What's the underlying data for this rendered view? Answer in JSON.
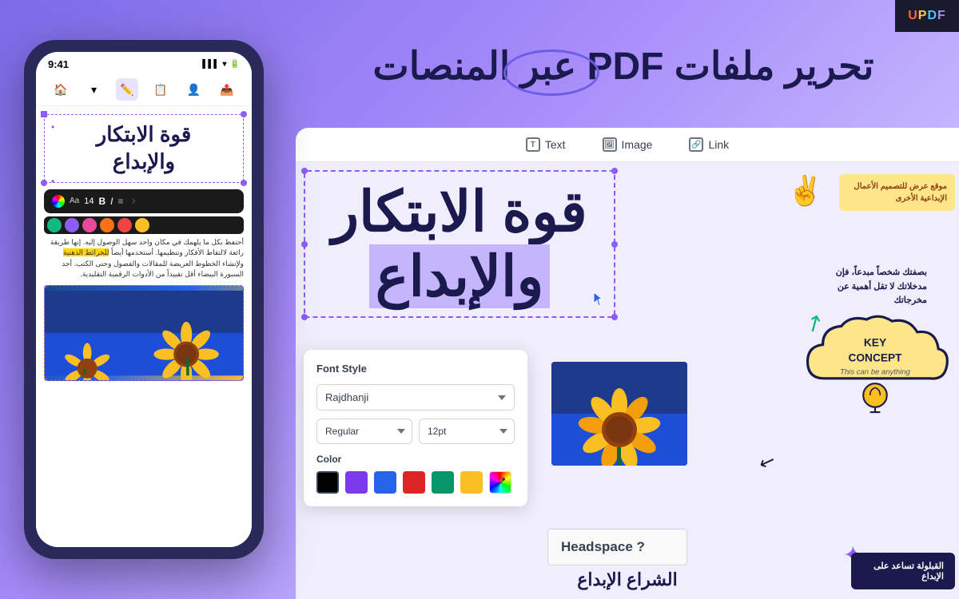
{
  "app": {
    "name": "UPDF",
    "logo_letters": {
      "u": "U",
      "p": "P",
      "d": "D",
      "f": "F"
    }
  },
  "main_title": "تحرير ملفات PDF عبر المنصات",
  "phone": {
    "time": "9:41",
    "signal": "▌▌▌",
    "wifi": "▾",
    "battery": "▮",
    "arabic_title": "قوة الابتكار والإبداع",
    "body_text": "أحتفظ بكل ما يلهمك في مكان واحد سهل الوصول إليه. إنها طريقة رائعة لالتقاط الأفكار وتنظيمها. أستخدمها أيضاً للخرائط الذهنية ولإنشاء الخطوط العريضة للمقالات والفصول وحتى الكتب. أجد السبورة البيضاء أقل تقييداً من الأدوات الرقمية التقليدية.",
    "highlighted_word": "الذهنية",
    "image_alt": "Sunflower on blue background"
  },
  "desktop": {
    "toolbar": {
      "text_label": "Text",
      "image_label": "Image",
      "link_label": "Link"
    },
    "arabic_title_line1": "قوة الابتكار",
    "arabic_title_line2": "والإبداع",
    "font_panel": {
      "title": "Font Style",
      "font_family": "Rajdhanji",
      "font_style": "Regular",
      "font_size": "12pt",
      "color_label": "Color",
      "colors": [
        "#000000",
        "#7c3aed",
        "#2563eb",
        "#dc2626",
        "#059669",
        "#fbbf24"
      ],
      "picker_label": "color-picker"
    },
    "deco_text_1": "موقع عرض للتصميم الأعمال الإبداعية الأخرى",
    "key_concept_label": "KEY CONCEPT",
    "key_concept_sub": "This can be anything",
    "headspace_label": "Headspace ?",
    "rtl_middle": "بصفتك شخصاً مبدعاً، فإن مدخلاتك لا تقل أهمية عن مخرجاتك",
    "bottom_card": "القبلولة تساعد على الإبداع",
    "bottom_text": "الشراع الإبداع"
  },
  "colors": {
    "background_start": "#7c6be8",
    "background_end": "#c4b5fd",
    "dark_navy": "#1a1a4e",
    "purple": "#8b5cf6",
    "yellow": "#fbbf24",
    "green": "#10b981"
  }
}
